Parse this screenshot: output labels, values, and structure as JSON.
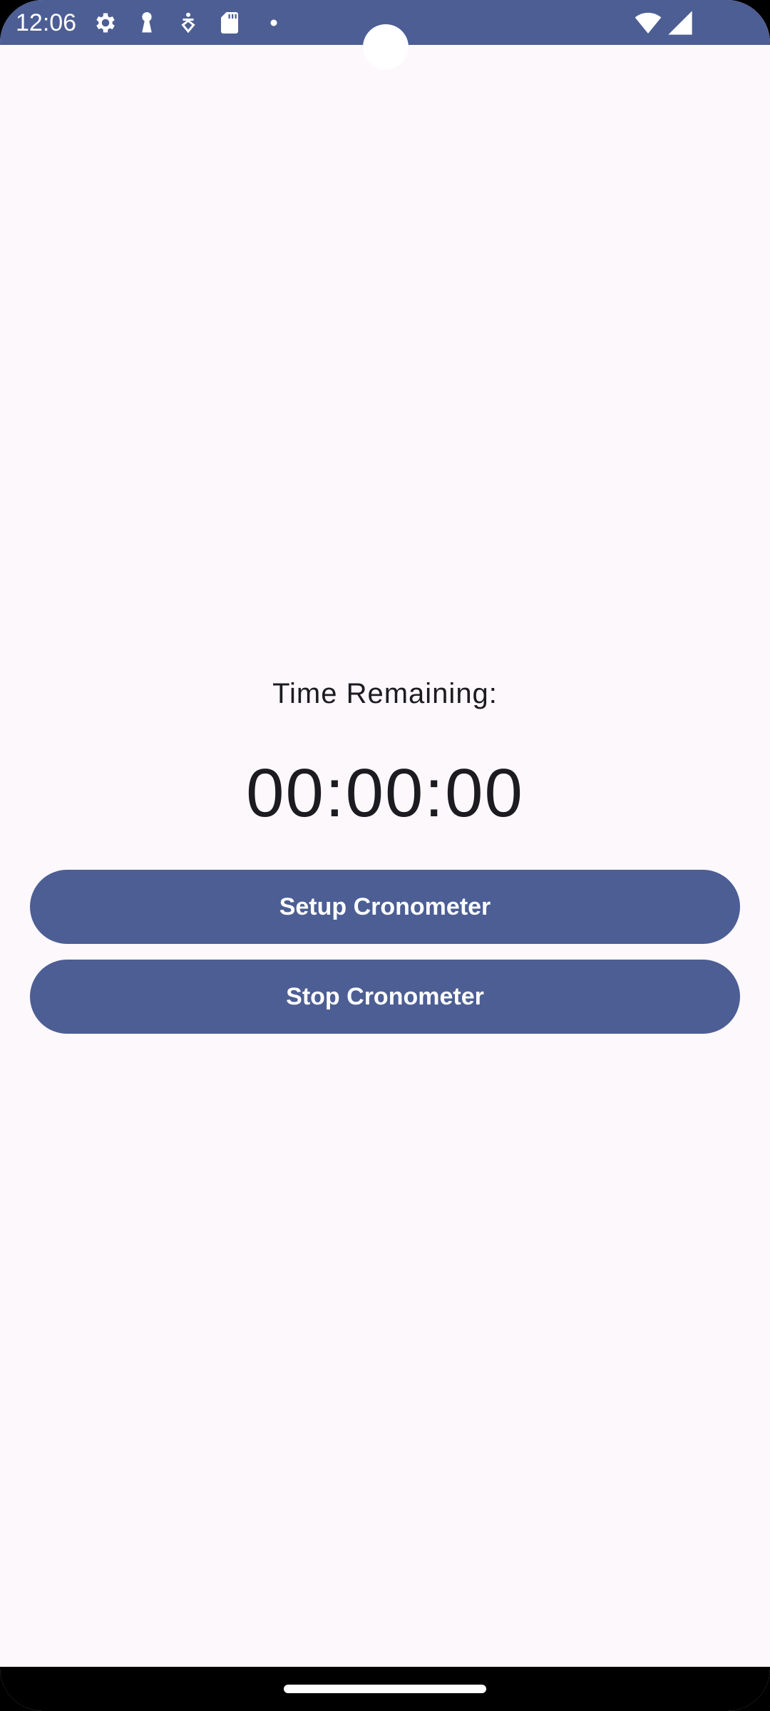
{
  "status_bar": {
    "time": "12:06",
    "icons": [
      "settings-icon",
      "keyhole-icon",
      "accessibility-icon",
      "sd-card-icon",
      "dot-icon",
      "wifi-icon",
      "signal-icon"
    ]
  },
  "timer": {
    "label": "Time Remaining:",
    "value": "00:00:00"
  },
  "buttons": {
    "setup_label": "Setup Cronometer",
    "stop_label": "Stop Cronometer"
  },
  "colors": {
    "primary": "#4c5e94",
    "background": "#fcf8fc",
    "text": "#1c1b1f"
  }
}
